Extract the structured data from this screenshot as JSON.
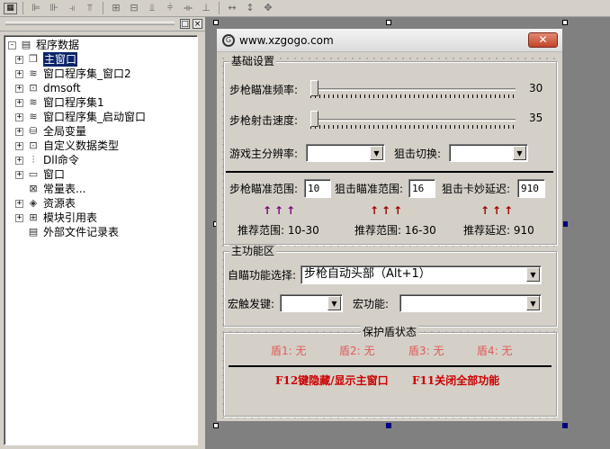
{
  "toolbar": {
    "buttons": [
      "grid-icon",
      "align-left-icon",
      "align-center-icon",
      "align-right-icon",
      "align-top-icon",
      "align-middle-icon",
      "align-bottom-icon",
      "center-h-icon",
      "center-v-icon",
      "same-width-icon",
      "same-height-icon",
      "same-size-icon"
    ]
  },
  "panel": {
    "restore_btn": "□",
    "close_btn": "×"
  },
  "tree": {
    "root": "程序数据",
    "items": [
      {
        "label": "主窗口",
        "expand": "+",
        "icon": "window-icon",
        "selected": true
      },
      {
        "label": "窗口程序集_窗口2",
        "expand": "+",
        "icon": "module-icon"
      },
      {
        "label": "dmsoft",
        "expand": "+",
        "icon": "class-icon"
      },
      {
        "label": "窗口程序集1",
        "expand": "+",
        "icon": "module-icon"
      },
      {
        "label": "窗口程序集_启动窗口",
        "expand": "+",
        "icon": "module-icon"
      },
      {
        "label": "全局变量",
        "expand": "+",
        "icon": "variable-icon"
      },
      {
        "label": "自定义数据类型",
        "expand": "+",
        "icon": "datatype-icon"
      },
      {
        "label": "Dll命令",
        "expand": "+",
        "icon": "dll-icon"
      },
      {
        "label": "窗口",
        "expand": "+",
        "icon": "form-icon"
      },
      {
        "label": "常量表...",
        "expand": "",
        "icon": "constant-icon"
      },
      {
        "label": "资源表",
        "expand": "+",
        "icon": "resource-icon"
      },
      {
        "label": "模块引用表",
        "expand": "+",
        "icon": "reference-icon"
      },
      {
        "label": "外部文件记录表",
        "expand": "",
        "icon": "file-icon"
      }
    ]
  },
  "form": {
    "title": "www.xzgogo.com",
    "close": "✕",
    "basic": {
      "group": "基础设置",
      "aim_freq_label": "步枪瞄准频率:",
      "aim_freq_value": "30",
      "aim_freq_level": 0.0,
      "shoot_speed_label": "步枪射击速度:",
      "shoot_speed_value": "35",
      "shoot_speed_level": 0.0,
      "resolution_label": "游戏主分辨率:",
      "resolution_value": "",
      "sniper_switch_label": "狙击切换:",
      "sniper_switch_value": "",
      "rifle_range_label": "步枪瞄准范围:",
      "rifle_range_value": "10",
      "sniper_range_label": "狙击瞄准范围:",
      "sniper_range_value": "16",
      "sniper_delay_label": "狙击卡妙延迟:",
      "sniper_delay_value": "910",
      "arrows": "↑↑↑",
      "rec_rifle": "推荐范围: 10-30",
      "rec_sniper": "推荐范围: 16-30",
      "rec_delay": "推荐延迟: 910"
    },
    "main": {
      "group": "主功能区",
      "aim_select_label": "自瞄功能选择:",
      "aim_select_value": "步枪自动头部（Alt+1）",
      "macro_key_label": "宏触发键:",
      "macro_key_value": "",
      "macro_func_label": "宏功能:",
      "macro_func_value": ""
    },
    "shield": {
      "group": "保护盾状态",
      "s1": "盾1: 无",
      "s2": "盾2: 无",
      "s3": "盾3: 无",
      "s4": "盾4: 无",
      "hotkey1": "F12键隐藏/显示主窗口",
      "hotkey2": "F11关闭全部功能"
    },
    "colors": {
      "shield_text": "#e05a5a",
      "hotkey_text": "#cc0000",
      "arrow_rifle": "#800080",
      "arrow_other": "#a00000"
    }
  }
}
